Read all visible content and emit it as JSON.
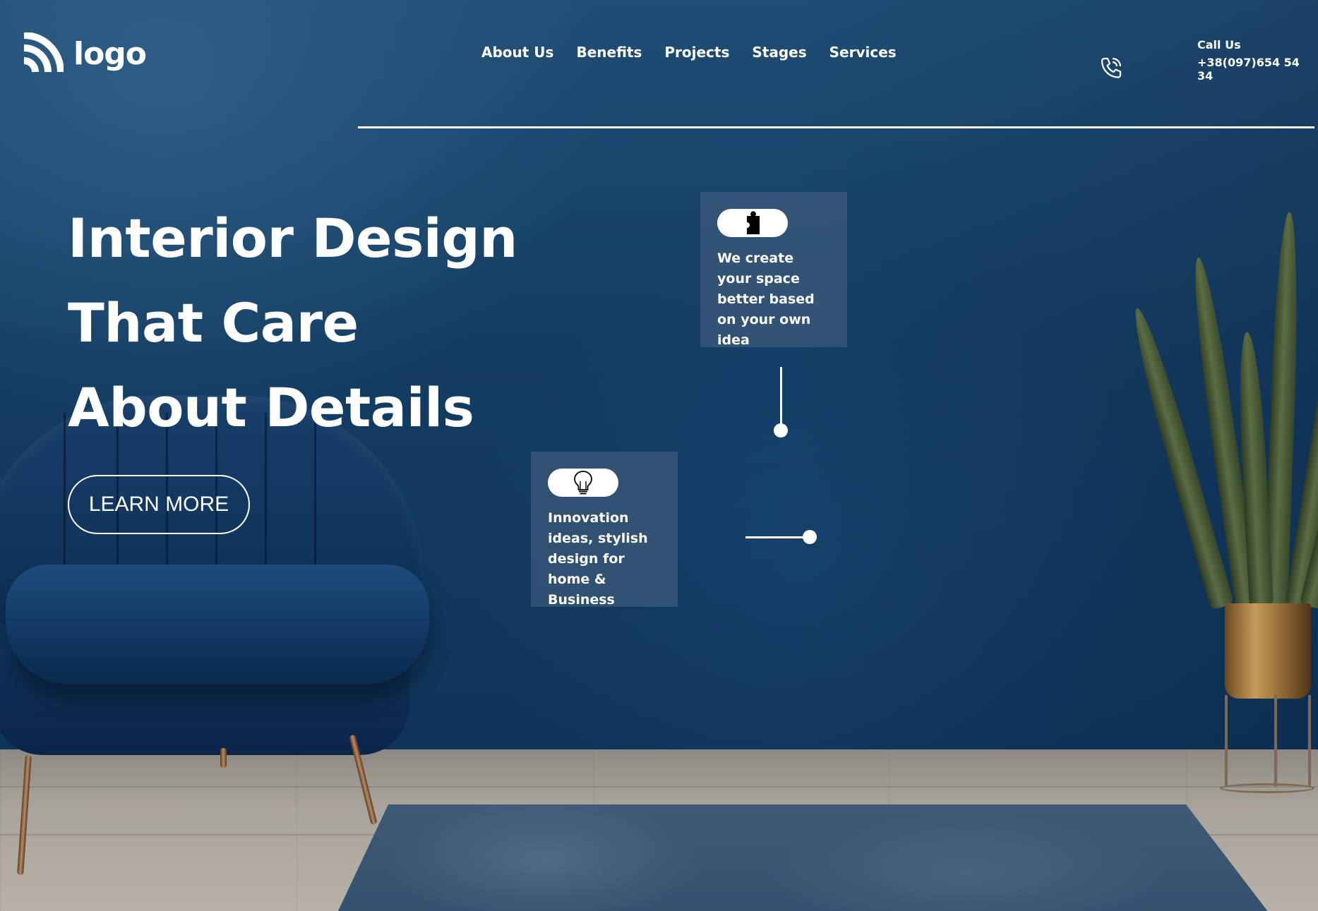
{
  "brand": {
    "logo_text": "logo",
    "logo_icon": "wifi-arcs-icon"
  },
  "nav": {
    "items": [
      {
        "label": "About Us"
      },
      {
        "label": "Benefits"
      },
      {
        "label": "Projects"
      },
      {
        "label": "Stages"
      },
      {
        "label": "Services"
      }
    ]
  },
  "contact": {
    "icon": "phone-icon",
    "label": "Call Us",
    "number": "+38(097)654 54 34"
  },
  "hero": {
    "lines": [
      "Interior Design",
      "That Care",
      "About Details"
    ],
    "cta_label": "LEARN MORE"
  },
  "features": [
    {
      "icon": "puzzle-piece-icon",
      "text": "We create your space better based on your own idea"
    },
    {
      "icon": "lightbulb-icon",
      "text": "Innovation ideas, stylish design for home & Business"
    }
  ],
  "colors": {
    "wall": "#143d63",
    "card": "#44607c",
    "text": "#ffffff"
  }
}
